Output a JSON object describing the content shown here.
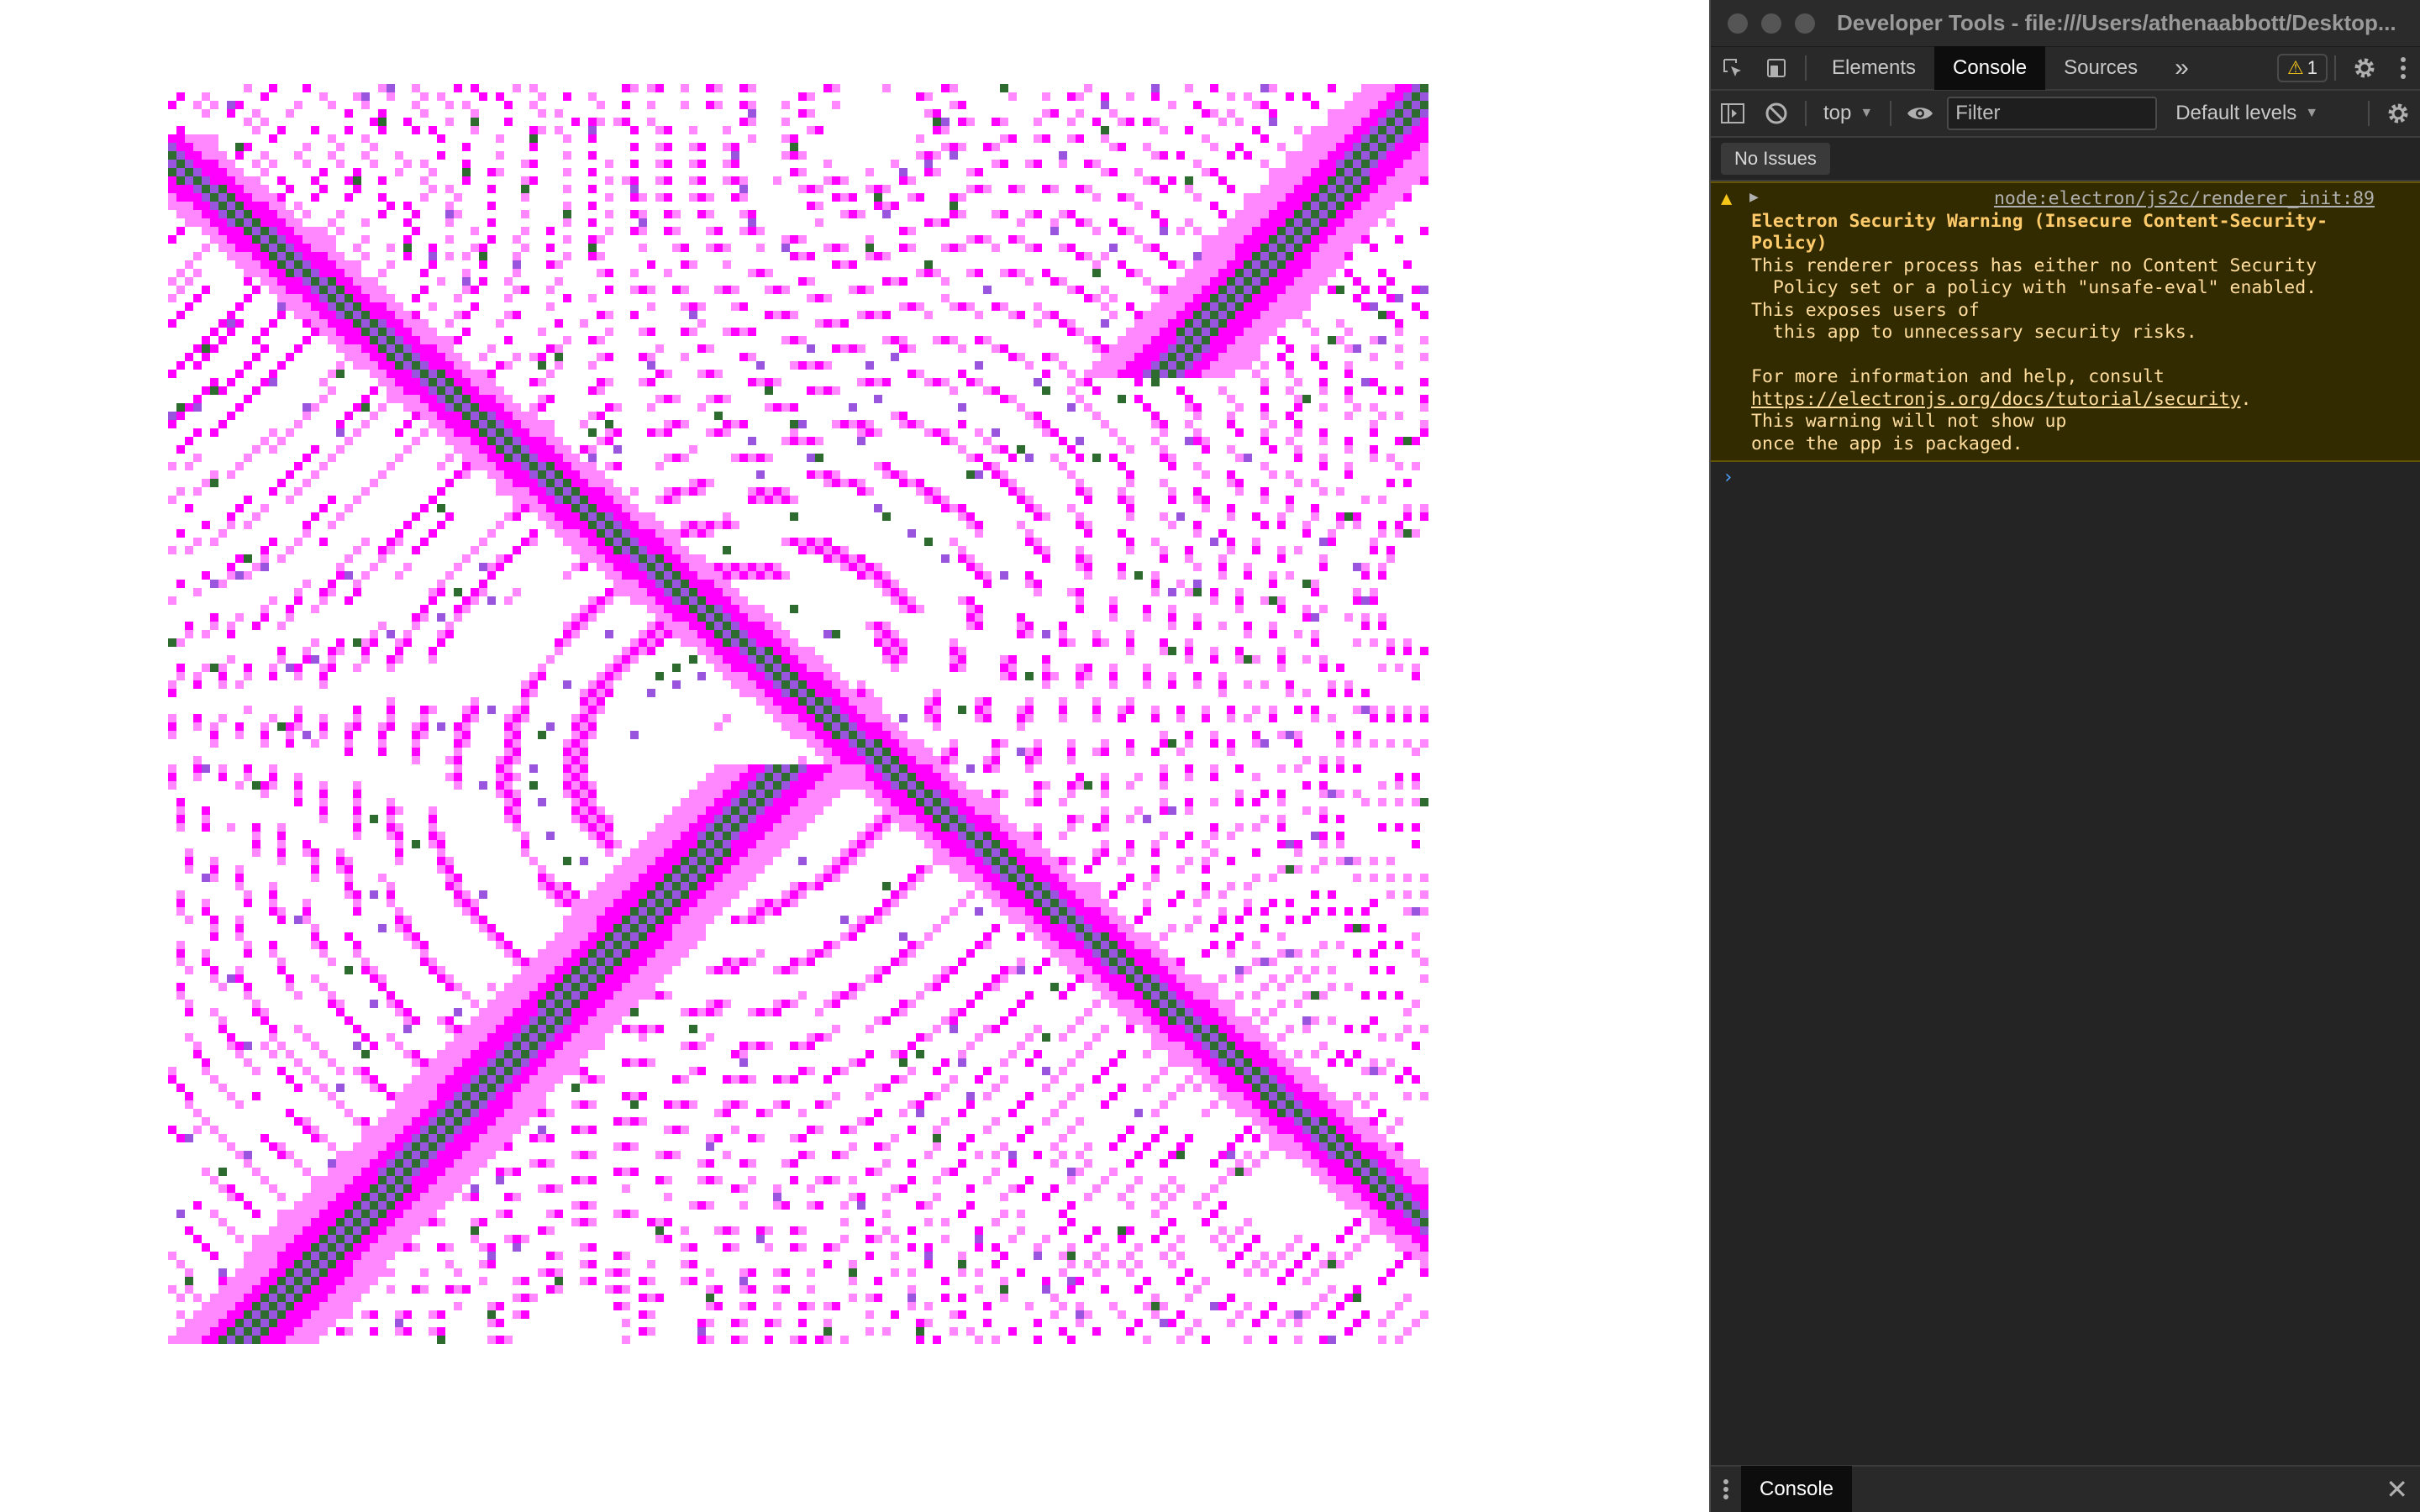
{
  "canvas": {
    "colors": {
      "background": "#ffffff",
      "magenta": "#ff00ff",
      "pink": "#ff88ff",
      "violet": "#9955dd",
      "green": "#2e6b2e"
    }
  },
  "devtools": {
    "window_title": "Developer Tools - file:///Users/athenaabbott/Desktop...",
    "tabs": [
      {
        "label": "Elements"
      },
      {
        "label": "Console",
        "active": true
      },
      {
        "label": "Sources"
      }
    ],
    "more_tabs_label": "»",
    "warning_badge": {
      "icon": "⚠",
      "count": "1"
    },
    "toolbar": {
      "context": "top",
      "filter_placeholder": "Filter",
      "levels": "Default levels"
    },
    "issues_label": "No Issues",
    "message": {
      "level": "warning",
      "source": "node:electron/js2c/renderer_init:89",
      "title_lines": [
        "Electron Security Warning (Insecure Content-Security-",
        "Policy)"
      ],
      "body_lines": [
        "This renderer process has either no Content Security",
        "  Policy set or a policy with \"unsafe-eval\" enabled.",
        "This exposes users of",
        "  this app to unnecessary security risks.",
        "",
        "For more information and help, consult"
      ],
      "link": "https://electronjs.org/docs/tutorial/security",
      "link_suffix": ".",
      "tail_lines": [
        "This warning will not show up",
        "once the app is packaged."
      ]
    },
    "prompt": "›",
    "drawer": {
      "tab": "Console",
      "close": "✕"
    }
  }
}
